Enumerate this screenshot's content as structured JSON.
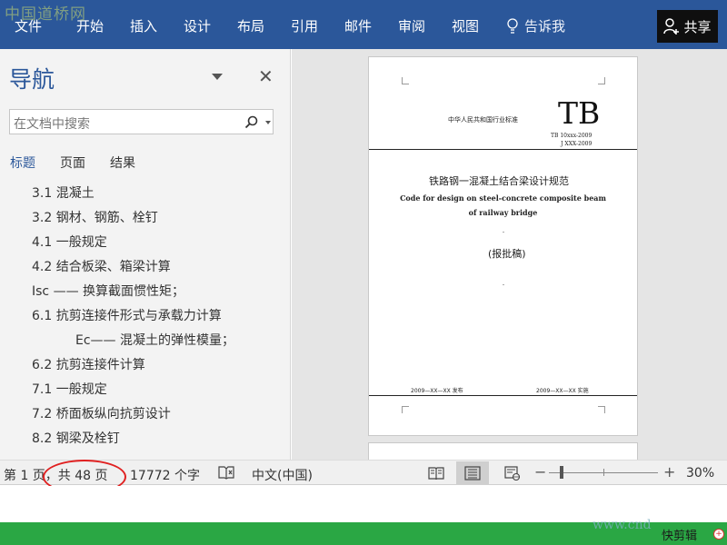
{
  "watermark_top": "中国道桥网",
  "ribbon": {
    "tabs": [
      "文件",
      "开始",
      "插入",
      "设计",
      "布局",
      "引用",
      "邮件",
      "审阅",
      "视图"
    ],
    "tell_me": "告诉我",
    "share": "共享"
  },
  "nav_pane": {
    "title": "导航",
    "search_placeholder": "在文档中搜索",
    "tabs": [
      "标题",
      "页面",
      "结果"
    ],
    "active_tab": "标题",
    "headings": [
      "3.1 混凝土",
      "3.2 钢材、钢筋、栓钉",
      "4.1  一般规定",
      "4.2 结合板梁、箱梁计算",
      "Isc —— 换算截面惯性矩；",
      "6.1 抗剪连接件形式与承载力计算",
      "Ec—— 混凝土的弹性模量；",
      "6.2 抗剪连接件计算",
      "7.1  一般规定",
      "7.2  桥面板纵向抗剪设计",
      "8.2 钢梁及栓钉"
    ]
  },
  "document": {
    "org": "中华人民共和国行业标准",
    "tb": "TB",
    "code1": "TB 10xxx-2009",
    "code2": "J XXX-2009",
    "title_cn": "铁路钢一混凝土结合梁设计规范",
    "title_en1": "Code for design on steel-concrete composite beam",
    "title_en2": "of railway bridge",
    "draft": "(报批稿)",
    "issue_date": "2009—XX—XX  发布",
    "impl_date": "2009—XX—XX  实施"
  },
  "status_bar": {
    "page": "第 1 页，共 48 页",
    "words": "17772 个字",
    "language": "中文(中国)",
    "zoom": "30%",
    "zoom_fraction": 0.1
  },
  "watermark_bottom": "www.cnd",
  "clip_label": "快剪辑",
  "accent_color": "#2b579a",
  "status_green": "#2aa744"
}
